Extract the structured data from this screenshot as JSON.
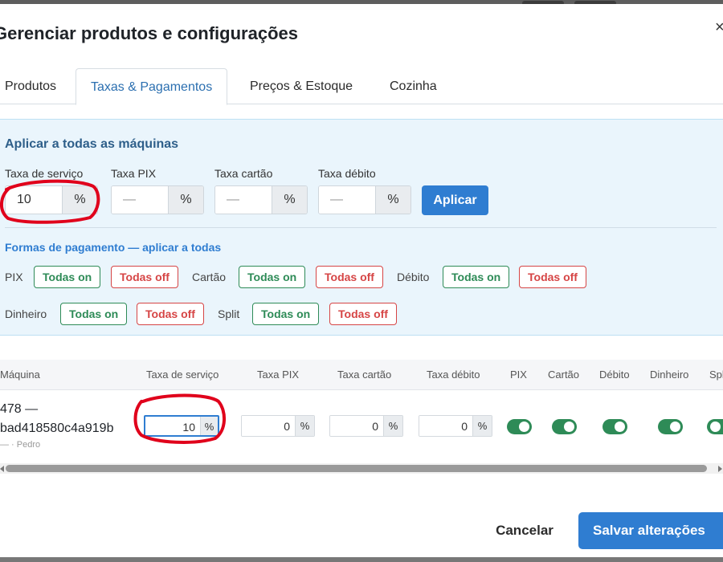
{
  "modal": {
    "title": "Gerenciar produtos e configurações",
    "close_glyph": "×"
  },
  "tabs": [
    {
      "label": "Produtos",
      "active": false
    },
    {
      "label": "Taxas & Pagamentos",
      "active": true
    },
    {
      "label": "Preços & Estoque",
      "active": false
    },
    {
      "label": "Cozinha",
      "active": false
    }
  ],
  "apply_all": {
    "title": "Aplicar a todas as máquinas",
    "fields": [
      {
        "label": "Taxa de serviço",
        "value": "10",
        "placeholder": "—",
        "unit": "%"
      },
      {
        "label": "Taxa PIX",
        "value": "",
        "placeholder": "—",
        "unit": "%"
      },
      {
        "label": "Taxa cartão",
        "value": "",
        "placeholder": "—",
        "unit": "%"
      },
      {
        "label": "Taxa débito",
        "value": "",
        "placeholder": "—",
        "unit": "%"
      }
    ],
    "apply_label": "Aplicar",
    "payments_title": "Formas de pagamento — aplicar a todas",
    "payments": [
      {
        "label": "PIX",
        "on": "Todas on",
        "off": "Todas off"
      },
      {
        "label": "Cartão",
        "on": "Todas on",
        "off": "Todas off"
      },
      {
        "label": "Débito",
        "on": "Todas on",
        "off": "Todas off"
      },
      {
        "label": "Dinheiro",
        "on": "Todas on",
        "off": "Todas off"
      },
      {
        "label": "Split",
        "on": "Todas on",
        "off": "Todas off"
      }
    ]
  },
  "table": {
    "headers": [
      "Máquina",
      "Taxa de serviço",
      "Taxa PIX",
      "Taxa cartão",
      "Taxa débito",
      "PIX",
      "Cartão",
      "Débito",
      "Dinheiro",
      "Split"
    ],
    "rows": [
      {
        "machine_line1": "478 —",
        "machine_line2": "bad418580c4a919b",
        "machine_sub": "— · Pedro",
        "rates": [
          {
            "value": "10",
            "unit": "%"
          },
          {
            "value": "0",
            "unit": "%"
          },
          {
            "value": "0",
            "unit": "%"
          },
          {
            "value": "0",
            "unit": "%"
          }
        ],
        "toggles": {
          "PIX": true,
          "Cartão": true,
          "Débito": true,
          "Dinheiro": true,
          "Split": true
        }
      }
    ]
  },
  "footer": {
    "cancel_label": "Cancelar",
    "save_label": "Salvar alterações"
  },
  "colors": {
    "accent": "#2f7dd1",
    "on": "#2e8b57",
    "off": "#d64545",
    "panel_bg": "#eaf5fc",
    "annotation": "#e0001b"
  }
}
